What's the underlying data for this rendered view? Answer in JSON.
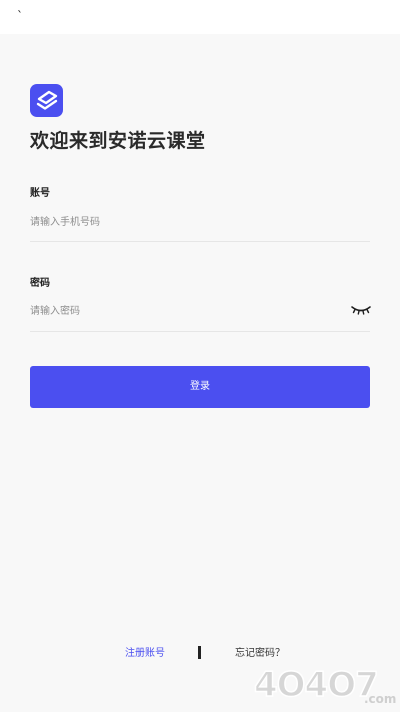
{
  "status_bar": {
    "mark": "`"
  },
  "header": {
    "title": "欢迎来到安诺云课堂"
  },
  "account": {
    "label": "账号",
    "placeholder": "请输入手机号码",
    "value": ""
  },
  "password": {
    "label": "密码",
    "placeholder": "请输入密码",
    "value": "",
    "visibility_icon": "eye-closed-icon"
  },
  "actions": {
    "login_label": "登录"
  },
  "footer": {
    "register_label": "注册账号",
    "forgot_label": "忘记密码？"
  },
  "watermark": {
    "text": "4O4O7",
    "suffix": ".com"
  },
  "colors": {
    "accent": "#4b4ff0",
    "background": "#f8f8f8",
    "text": "#2a2a2a",
    "placeholder": "#8d8d8d"
  }
}
